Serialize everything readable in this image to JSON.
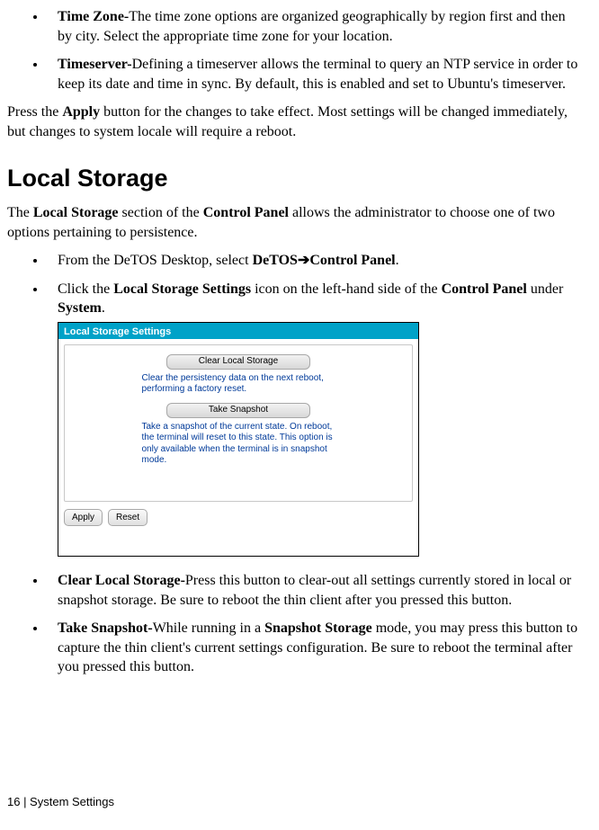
{
  "topBullets": [
    {
      "title": "Time Zone-",
      "text": "The time zone options are organized geographically by region first and then by city.  Select the appropriate time zone for your location."
    },
    {
      "title": "Timeserver-",
      "text": "Defining a timeserver allows the terminal to query an NTP service in order to keep its date and time in sync.  By default, this is enabled and set to Ubuntu's timeserver."
    }
  ],
  "applyPara": {
    "pre": "Press the ",
    "bold": "Apply",
    "post": " button for the changes to take effect.  Most settings will be changed immediately, but changes to system locale will require a reboot."
  },
  "heading": "Local Storage",
  "introPara": {
    "t1": "The ",
    "b1": "Local Storage",
    "t2": " section of the ",
    "b2": "Control Panel",
    "t3": " allows the administrator to choose one of two options pertaining to persistence."
  },
  "navBullets": {
    "first": {
      "pre": "From the DeTOS Desktop, select ",
      "boldPre": "DeTOS",
      "arrow": "➔",
      "boldPost": "Control Panel",
      "tail": "."
    },
    "second": {
      "t1": "Click the ",
      "b1": "Local Storage Settings",
      "t2": " icon on the left-hand side of the ",
      "b2": "Control Panel",
      "t3": " under ",
      "b3": "System",
      "t4": "."
    }
  },
  "screenshot": {
    "title": "Local Storage Settings",
    "clearBtn": "Clear Local Storage",
    "clearDesc": "Clear the persistency data on the next reboot, performing a factory reset.",
    "snapBtn": "Take Snapshot",
    "snapDesc": "Take a snapshot of the current state. On reboot, the terminal will reset to this state. This option is only available when the terminal is in snapshot mode.",
    "applyBtn": "Apply",
    "resetBtn": "Reset"
  },
  "bottomBullets": [
    {
      "title": "Clear Local Storage-",
      "text": "Press this button to clear-out all settings currently stored in local or snapshot storage.  Be sure to reboot the thin client after you pressed this button."
    }
  ],
  "snapshotBullet": {
    "title": "Take Snapshot-",
    "t1": "While running in a ",
    "b1": "Snapshot Storage",
    "t2": " mode, you may press this button to capture the thin client's current settings configuration.  Be sure to reboot the terminal after you pressed this button."
  },
  "footer": "16 | System Settings"
}
